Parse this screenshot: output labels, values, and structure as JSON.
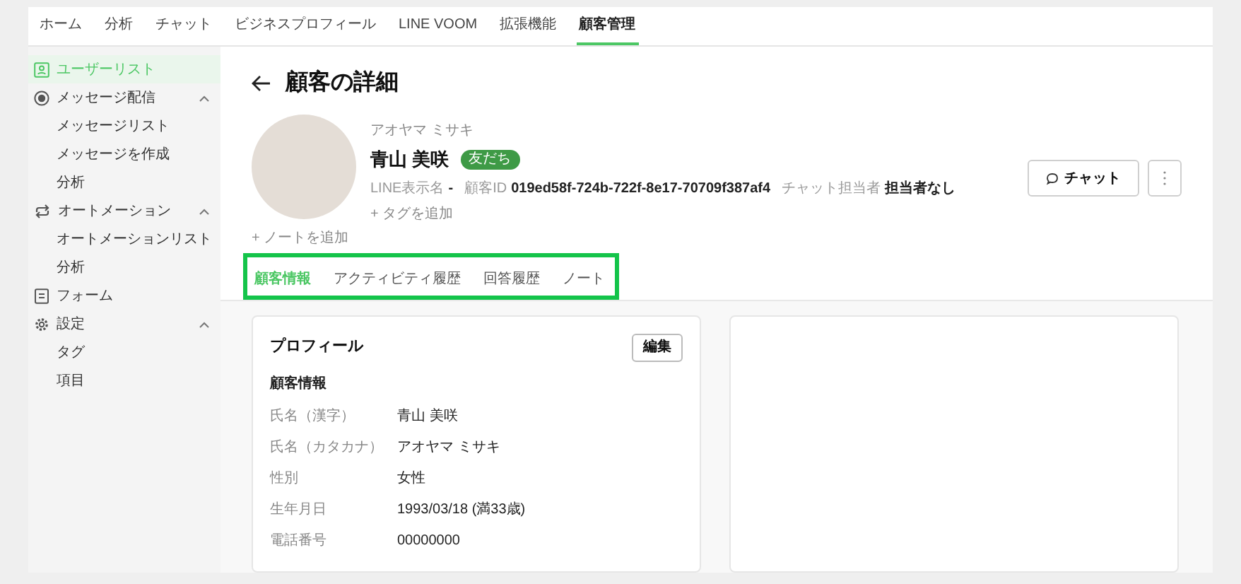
{
  "top_nav": [
    {
      "label": "ホーム",
      "selected": false
    },
    {
      "label": "分析",
      "selected": false
    },
    {
      "label": "チャット",
      "selected": false
    },
    {
      "label": "ビジネスプロフィール",
      "selected": false
    },
    {
      "label": "LINE VOOM",
      "selected": false
    },
    {
      "label": "拡張機能",
      "selected": false
    },
    {
      "label": "顧客管理",
      "selected": true
    }
  ],
  "sidebar": {
    "items": [
      {
        "label": "ユーザーリスト",
        "selected": true
      },
      {
        "label": "メッセージ配信",
        "selected": false,
        "expanded": true,
        "children": [
          {
            "label": "メッセージリスト",
            "selected": false
          },
          {
            "label": "メッセージを作成",
            "selected": false
          },
          {
            "label": "分析",
            "selected": false
          }
        ]
      },
      {
        "label": "オートメーション",
        "selected": false,
        "expanded": true,
        "children": [
          {
            "label": "オートメーションリスト",
            "selected": false
          },
          {
            "label": "分析",
            "selected": false
          }
        ]
      },
      {
        "label": "フォーム",
        "selected": false
      },
      {
        "label": "設定",
        "selected": false,
        "expanded": true,
        "children": [
          {
            "label": "タグ",
            "selected": false
          },
          {
            "label": "項目",
            "selected": false
          }
        ]
      }
    ]
  },
  "page_title": "顧客の詳細",
  "customer": {
    "kana": "アオヤマ ミサキ",
    "name": "青山 美咲",
    "badge": "友だち",
    "fields": [
      {
        "label": "LINE表示名",
        "value": "-"
      },
      {
        "label": "顧客ID",
        "value": "019ed58f-724b-722f-8e17-70709f387af4"
      },
      {
        "label": "チャット担当者",
        "value": "担当者なし"
      }
    ],
    "add_tag": "+ タグを追加"
  },
  "chat_button": "チャット",
  "add_note": "+ ノートを追加",
  "tabs": [
    {
      "label": "顧客情報",
      "selected": true
    },
    {
      "label": "アクティビティ履歴",
      "selected": false
    },
    {
      "label": "回答履歴",
      "selected": false
    },
    {
      "label": "ノート",
      "selected": false
    }
  ],
  "tabs_highlighted": true,
  "profile_card": {
    "title": "プロフィール",
    "edit_button": "編集",
    "section": "顧客情報",
    "rows": [
      {
        "label": "氏名（漢字）",
        "value": "青山 美咲"
      },
      {
        "label": "氏名（カタカナ）",
        "value": "アオヤマ ミサキ"
      },
      {
        "label": "性別",
        "value": "女性"
      },
      {
        "label": "生年月日",
        "value": "1993/03/18 (満33歳)"
      },
      {
        "label": "電話番号",
        "value": "00000000"
      }
    ]
  }
}
